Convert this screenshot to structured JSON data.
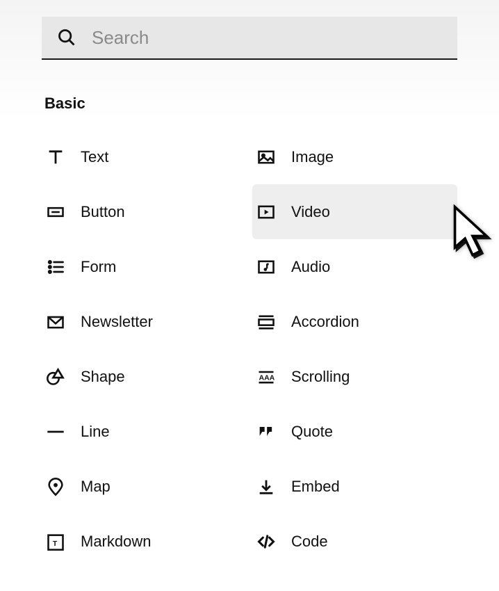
{
  "search": {
    "placeholder": "Search",
    "value": ""
  },
  "section": {
    "title": "Basic"
  },
  "blocks": {
    "left": [
      {
        "label": "Text",
        "icon": "text-icon"
      },
      {
        "label": "Button",
        "icon": "button-icon"
      },
      {
        "label": "Form",
        "icon": "form-icon"
      },
      {
        "label": "Newsletter",
        "icon": "newsletter-icon"
      },
      {
        "label": "Shape",
        "icon": "shape-icon"
      },
      {
        "label": "Line",
        "icon": "line-icon"
      },
      {
        "label": "Map",
        "icon": "map-icon"
      },
      {
        "label": "Markdown",
        "icon": "markdown-icon"
      }
    ],
    "right": [
      {
        "label": "Image",
        "icon": "image-icon"
      },
      {
        "label": "Video",
        "icon": "video-icon",
        "hovered": true
      },
      {
        "label": "Audio",
        "icon": "audio-icon"
      },
      {
        "label": "Accordion",
        "icon": "accordion-icon"
      },
      {
        "label": "Scrolling",
        "icon": "scrolling-icon"
      },
      {
        "label": "Quote",
        "icon": "quote-icon"
      },
      {
        "label": "Embed",
        "icon": "embed-icon"
      },
      {
        "label": "Code",
        "icon": "code-icon"
      }
    ]
  }
}
